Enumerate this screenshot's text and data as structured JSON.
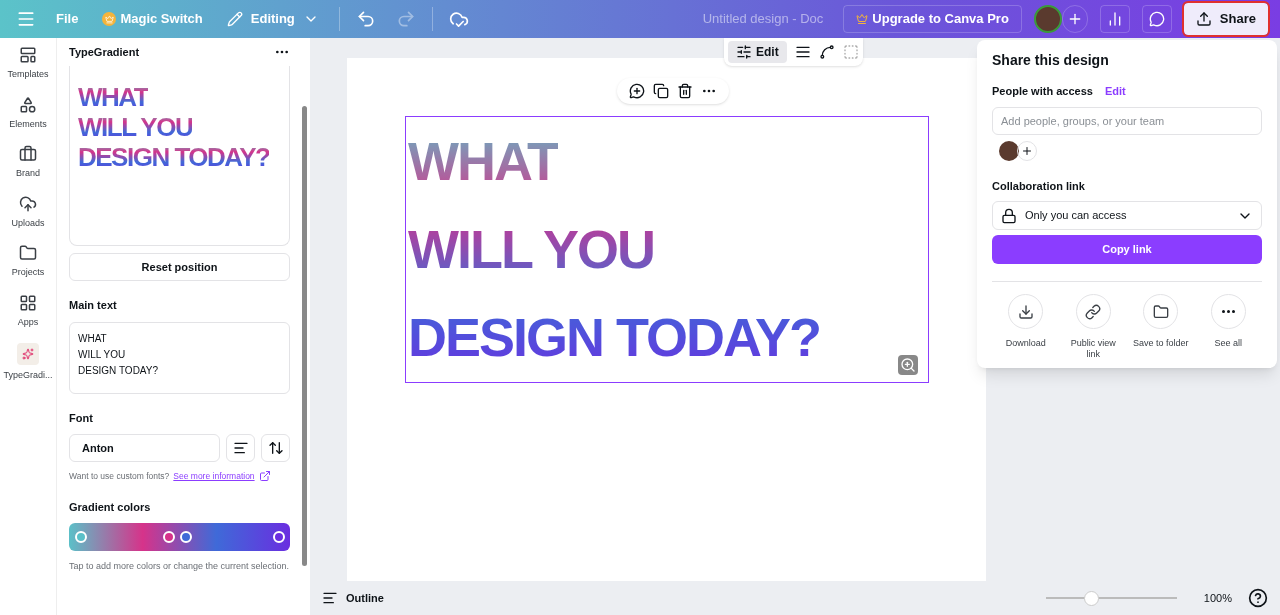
{
  "topbar": {
    "file": "File",
    "magic_switch": "Magic Switch",
    "mode": "Editing",
    "doc_title": "Untitled design - Doc",
    "upgrade": "Upgrade to Canva Pro",
    "share": "Share"
  },
  "rail": [
    {
      "label": "Templates"
    },
    {
      "label": "Elements"
    },
    {
      "label": "Brand"
    },
    {
      "label": "Uploads"
    },
    {
      "label": "Projects"
    },
    {
      "label": "Apps"
    },
    {
      "label": "TypeGradi..."
    }
  ],
  "panel": {
    "title": "TypeGradient",
    "preview_lines": [
      "WHAT",
      "WILL YOU",
      "DESIGN TODAY?"
    ],
    "reset": "Reset position",
    "main_text_label": "Main text",
    "main_text": "WHAT\nWILL YOU\nDESIGN TODAY?",
    "font_label": "Font",
    "font": "Anton",
    "font_hint": "Want to use custom fonts?",
    "font_link": "See more information",
    "gradient_label": "Gradient colors",
    "stops": [
      {
        "color": "#5bc0c8"
      },
      {
        "color": "#d6338a"
      },
      {
        "color": "#3f6ad8"
      },
      {
        "color": "#6a2ee0"
      }
    ],
    "gradient_hint": "Tap to add more colors or change the current selection."
  },
  "canvas": {
    "toolbar_edit": "Edit",
    "lines": [
      "WHAT",
      "WILL YOU",
      "DESIGN TODAY?"
    ]
  },
  "bottom": {
    "outline": "Outline",
    "zoom": {
      "level": 0.35
    },
    "zoom_reading": "100%"
  },
  "share": {
    "title": "Share this design",
    "people_label": "People with access",
    "edit": "Edit",
    "people_placeholder": "Add people, groups, or your team",
    "collab_label": "Collaboration link",
    "access": "Only you can access",
    "copy": "Copy link",
    "actions": [
      {
        "label": "Download"
      },
      {
        "label": "Public view link"
      },
      {
        "label": "Save to folder"
      },
      {
        "label": "See all"
      }
    ]
  }
}
